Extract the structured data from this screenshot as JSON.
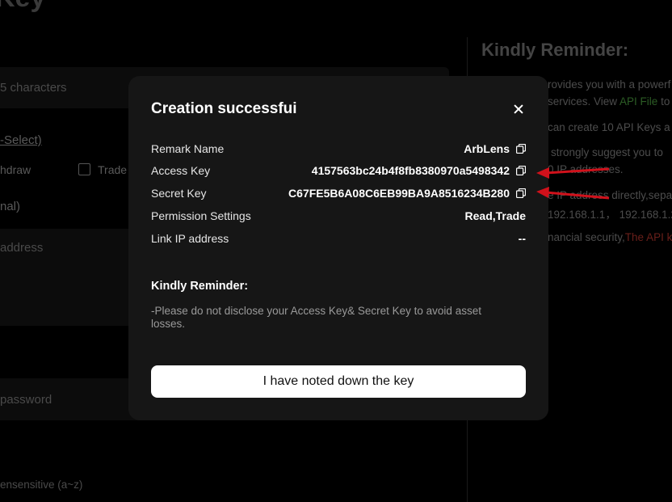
{
  "background": {
    "page_title": "Key",
    "name_placeholder": "5 characters",
    "permissions_label": "-Select)",
    "withdraw_label": "hdraw",
    "trade_label": "Trade",
    "ip_label": "nal)",
    "ip_placeholder": "address",
    "password_placeholder": "password",
    "case_hint": "ensensitive (a~z)",
    "reminder_title": "Kindly Reminder:",
    "reminder_lines": {
      "l1": "rovides you with a powerf",
      "l2a": "services. View ",
      "l2b": "API File",
      "l2c": " to",
      "l3": "can create 10 API Keys a",
      "l4": "strongly suggest you to",
      "l5": "0 IP addresses.",
      "l6": "e IP address directly,sepa",
      "l7": "192.168.1.1， 192.168.1.2",
      "l8a": "nancial security,",
      "l8b": "The API k"
    }
  },
  "modal": {
    "title": "Creation successfui",
    "fields": [
      {
        "label": "Remark Name",
        "value": "ArbLens"
      },
      {
        "label": "Access Key",
        "value": "4157563bc24b4f8fb8380970a5498342"
      },
      {
        "label": "Secret Key",
        "value": "C67FE5B6A08C6EB99BA9A8516234B280"
      },
      {
        "label": "Permission Settings",
        "value": "Read,Trade"
      },
      {
        "label": "Link IP address",
        "value": "--"
      }
    ],
    "reminder_title": "Kindly Reminder:",
    "reminder_text": "-Please do not disclose your Access Key& Secret Key to avoid asset losses.",
    "confirm_button": "I have noted down the key"
  },
  "colors": {
    "annotation_arrow": "#d0111b"
  }
}
